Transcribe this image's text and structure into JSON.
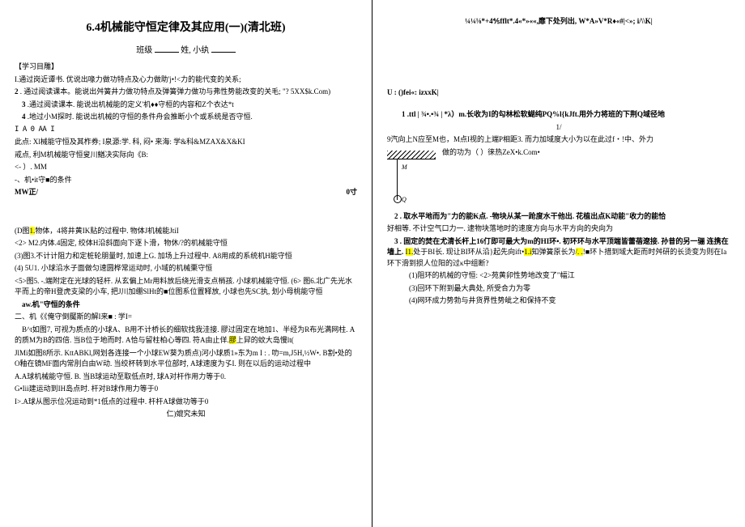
{
  "doc": {
    "title": "6.4机械能守恒定律及其应用(一)(清北班)",
    "classline_prefix": "班级 ",
    "classline_mid": "姓, 小纨 ",
    "study_header": "【学习目雕】",
    "p1": "I.通过岗近谭书. 优说出喙力做功特点及心力做助'j•!<力的能代变的关系;",
    "p2_label": "2",
    "p2": "  . 通过阅读课本。能说出舛簧井力做功特点及弹簧弹力做功与弗性势能改变的关毛; \"? 5XX$k.Com)",
    "p3_label": "3",
    "p3": "  .通过阅读课本. 能说出机械能的定义'机♦♦守桓的内容和Z个衣达*t",
    "p4_label": "4",
    "p4": "  .地过小M探时. 能说出机械的守恒的条件舟会推断小个或系统是否守恒.",
    "p5": "I A 0 AA I",
    "p6": "此点: Xl械能守恒及其柞券; I泉源:学. 科, 闷• 来海: 学&科&MZAX&X&KI",
    "p7": "戒点, 利M机械能守恒叟川鰌决实际向《B:",
    "p8": "<- ）. MM",
    "p9": "-、机•it守■的条件",
    "p10": "MW正/",
    "p10_right": "0寸",
    "p11": "(D图",
    "p11_hl": "1.",
    "p11b": "物体，4将井黄IK贴的过程中. 物体J机械能JtiI",
    "p12": "<2> M2.内体.4固定, 绞体H沿斜面向下逐卜滑，物休/?的机械能守恒",
    "p13": "(3)图3.不计计阻力和定桩轮朋量时, 加速上G. 加场上升过程中. A8用成的系统机H能守恒",
    "p14": "   (4) 5U1. 小球沿水子面做匀速圆桦常运动时, 小域的机械栗守恒",
    "p15": "<5>图5. -.端附定在光球的轻杆. 从玄偏上Mr用料放后绕光滑支点梢孩. 小球机械能守恒. (6> 图6.北广先光水平而上的帝H登虎支梁的小车, 把J川加绷SlHt的■位图系位置释放, 小球也先SC执, 划小母桃能守恒",
    "p16": "aw.机\"守恒的条件",
    "p17": "  二、机《《俺守倒魘斯的解I来■ : 学I=",
    "p18": "B^t如图7, 可视为质点的小球A、B用不计桥长的细软找我洼接. 膠过固定在地加1、半经为R布光满网柱. A的质M为B的四倍. 当B位于地而时. A恰与留柱柏心等四. 符A由止佯.",
    "p18_hl": "膠",
    "p18c": "上舁的蚊大岛慢lt(",
    "p19": "  JlMi如图8所示. KttABKl,网划各连接一个小球EW葵为质点)河小球质1»东为m I : . 叻=m,J5H,½W•. B割•处的O釉在镜MF面内常刖白由W动. 当绞杯转到水平位部时, A球速度为孓I. 则在以后的运动过程中",
    "p20": "A.A球机械能守恒. B. 当B球运动至取低点时, 球A对杆作用力等于0.",
    "p21": "G•Iii建运动到IH岛点时. 杆对B球作用力等于0",
    "p22": "I>.A球从图示位况运动到*1低点的过程中. 杆杆A球做功等于0",
    "p23": "仁)媲究未知",
    "r_top": "¼¼⅛*+4⅘fflt*.4«*»««,靡下处列出, W*A»V*R♦«#|<»; i/\\\\K|",
    "r_u": "U :   ()fei«: izxxK|",
    "r_1": "1   .ttl | ¾•.•¾ | *λ）m.长收为I的勾林松软蝴纯PQ%l{kJft.用外力将班的下荆Q域径地",
    "r_1b": "1/",
    "r_9": "9汽向上N应至M也，M点I视的上端P相距3. 而力加域度大小为以在此过f・!中、外力",
    "r_after9": "做的功为（     ）徕热ZeX•k.Com•",
    "r_2": "2   . 取水平地而为\"力的能₭点. -物块从某一跄度水干他出. 花植出点K动能\"收力的能恰",
    "r_2b": "好相等. 不计空气口力一. 逮物块落地时的速度方向与水平方向的央向为",
    "r_3": "3   . 固定的焚在尤清长杆上16仃即可最大为m的HI环•. 初环环与水平顶端皆蕾蓓遼接. 孙昔的另一骊 连携在墙上. ",
    "r_3_hl1": "I1.",
    "r_3_mid": "处于BI长. 现让BI环从沿}起先向ift•",
    "r_3_hl2": "1.i",
    "r_3_end": "知弹簧原长为",
    "r_3_hl3": "/. .",
    "r_3_tail": "!■环卜措到域大距而时舛研的长烫变为则在Ia环下滑到损人位阳的过κ中组断?",
    "r_li1": "(1)阻环的机械的守恒: <2>苑黄卯性势地改变了\"幅江",
    "r_li2": "(3)回环下附到最大典处, 所受合力为零",
    "r_li3": "(4)网环成力势勃与井货界性势皉之和保持不变"
  }
}
